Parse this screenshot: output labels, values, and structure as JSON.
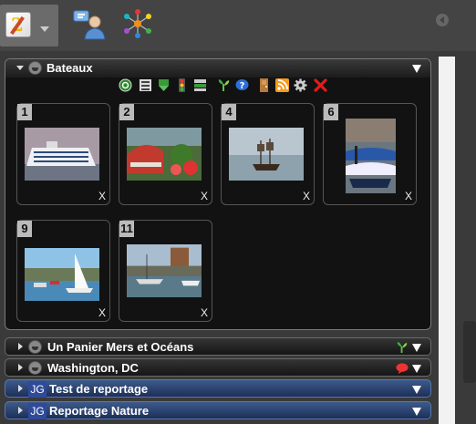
{
  "topbar": {
    "app_logo_num": "2",
    "app_menu_icon": "app-logo-icon",
    "users_icon": "users-chat-icon",
    "network_icon": "network-icon"
  },
  "groups": [
    {
      "title": "Bateaux",
      "icon": "basket-icon",
      "expanded": true,
      "toolbar_icons": [
        "refresh-icon",
        "list-icon",
        "download-icon",
        "traffic-light-icon",
        "stack-icon",
        "plant-icon",
        "help-icon",
        "door-icon",
        "rss-icon",
        "gear-icon",
        "delete-icon"
      ],
      "photos": [
        {
          "number": "1",
          "subject": "cruise-ship-photo",
          "remove": "X"
        },
        {
          "number": "2",
          "subject": "red-boat-garden-photo",
          "remove": "X"
        },
        {
          "number": "4",
          "subject": "sailing-galleon-photo",
          "remove": "X"
        },
        {
          "number": "6",
          "subject": "fishing-boats-photo",
          "remove": "X"
        },
        {
          "number": "9",
          "subject": "harbor-sailboat-photo",
          "remove": "X"
        },
        {
          "number": "11",
          "subject": "marina-boats-photo",
          "remove": "X"
        }
      ]
    },
    {
      "title": "Un Panier Mers et Océans",
      "icon": "basket-icon",
      "side_icon": "plant-icon",
      "expanded": false
    },
    {
      "title": "Washington, DC",
      "icon": "basket-icon",
      "side_icon": "speech-bubble-icon",
      "expanded": false
    },
    {
      "title": "Test de reportage",
      "icon": "JG",
      "expanded": false
    },
    {
      "title": "Reportage Nature",
      "icon": "JG",
      "expanded": false
    }
  ],
  "colors": {
    "background": "#4a4a4a",
    "panel": "#121212",
    "accent_blue": "#2f4a9a"
  }
}
